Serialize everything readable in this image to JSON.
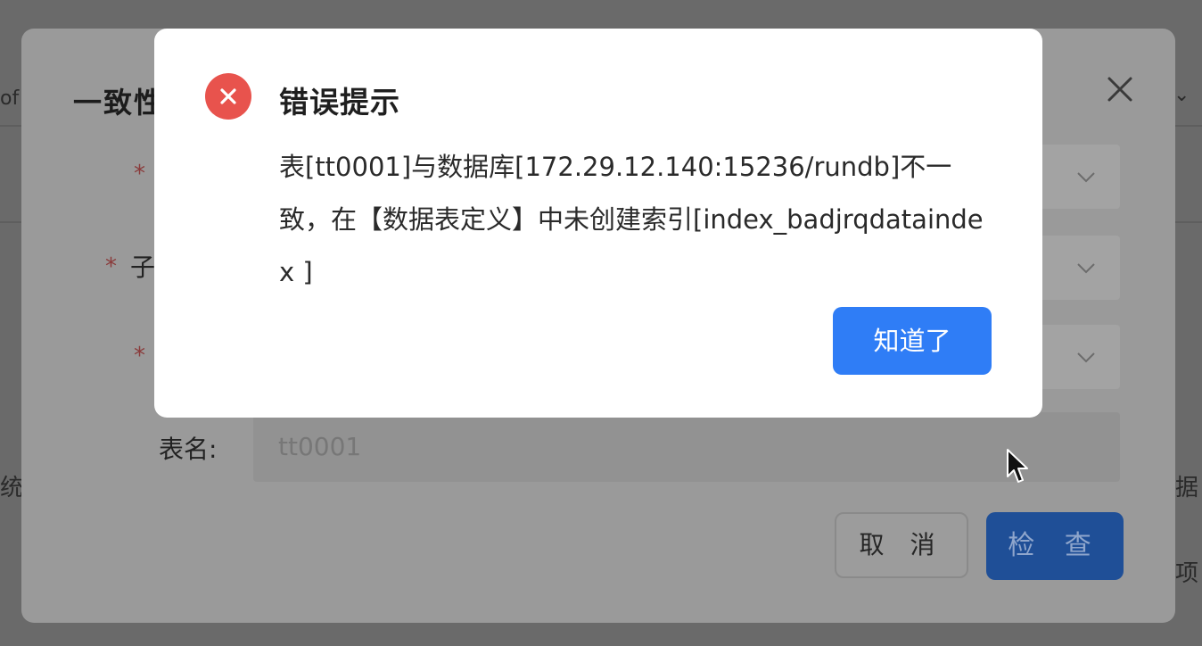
{
  "background": {
    "left_fragment_top": "of",
    "left_fragment_mid": "统",
    "right_fragment_top": "⌄",
    "right_fragment_mid": "据",
    "right_fragment_low": "项"
  },
  "form_modal": {
    "title": "一致性",
    "fields": [
      {
        "label": "",
        "required": true
      },
      {
        "label": "子",
        "required": true
      },
      {
        "label": "",
        "required": true
      }
    ],
    "table_name_label": "表名:",
    "table_name_value": "tt0001",
    "cancel_label": "取 消",
    "check_label": "检 查"
  },
  "error_dialog": {
    "title": "错误提示",
    "message": "表[tt0001]与数据库[172.29.12.140:15236/rundb]不一致，在【数据表定义】中未创建索引[index_badjrqdataindex ]",
    "ok_label": "知道了"
  },
  "colors": {
    "error_red": "#e8534d",
    "primary_blue": "#2f7df6"
  },
  "icons": {
    "error": "error-circle-icon",
    "close": "close-icon",
    "chevron": "chevron-down-icon",
    "cursor": "mouse-cursor-icon"
  }
}
